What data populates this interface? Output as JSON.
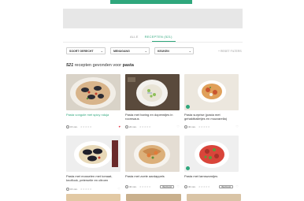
{
  "tabs": [
    {
      "label": "Alle",
      "active": false
    },
    {
      "label": "Recepten (521)",
      "active": true
    }
  ],
  "filters": {
    "course": "Soort gerecht",
    "menu": "Menugang",
    "kitchen": "Keuken",
    "reset": "+ Reset filters"
  },
  "results": {
    "count": "521",
    "text": " recepten gevonden voor ",
    "query": "pasta"
  },
  "cards": [
    {
      "title": "Pasta vongole met spicy nduja",
      "time": "15 min.",
      "title_color": "#2fa77c",
      "favorited": true,
      "save_label": ""
    },
    {
      "title": "Pasta met haring en doperwtjes in roomsaus",
      "time": "20 min.",
      "title_color": "#333333",
      "favorited": false,
      "save_label": ""
    },
    {
      "title": "Pasta surprise (pasta met gehaktballetjes en mozzarella)",
      "time": "30 min.",
      "title_color": "#333333",
      "favorited": false,
      "save_label": ""
    },
    {
      "title": "Pasta met mosselen met tomaat, knoflook, peterselie en citroen",
      "time": "15 min.",
      "title_color": "#333333",
      "favorited": false,
      "save_label": ""
    },
    {
      "title": "Pasta met zoete aardappels",
      "time": "30 min.",
      "title_color": "#333333",
      "favorited": false,
      "save_label": "Bewaar"
    },
    {
      "title": "Pasta met lamsworstjes",
      "time": "30 min.",
      "title_color": "#333333",
      "favorited": false,
      "save_label": "Bewaar"
    }
  ],
  "colors": {
    "accent": "#2fa77c",
    "heart_active": "#e53b4a"
  }
}
